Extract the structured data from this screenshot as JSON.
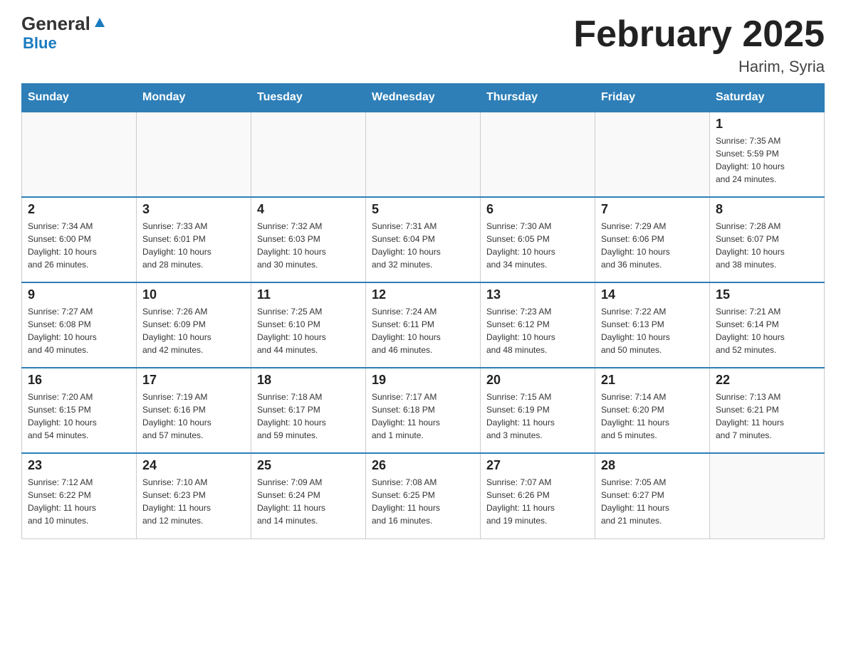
{
  "logo": {
    "general": "General",
    "blue": "Blue"
  },
  "title": "February 2025",
  "location": "Harim, Syria",
  "days_of_week": [
    "Sunday",
    "Monday",
    "Tuesday",
    "Wednesday",
    "Thursday",
    "Friday",
    "Saturday"
  ],
  "weeks": [
    [
      {
        "day": "",
        "info": ""
      },
      {
        "day": "",
        "info": ""
      },
      {
        "day": "",
        "info": ""
      },
      {
        "day": "",
        "info": ""
      },
      {
        "day": "",
        "info": ""
      },
      {
        "day": "",
        "info": ""
      },
      {
        "day": "1",
        "info": "Sunrise: 7:35 AM\nSunset: 5:59 PM\nDaylight: 10 hours\nand 24 minutes."
      }
    ],
    [
      {
        "day": "2",
        "info": "Sunrise: 7:34 AM\nSunset: 6:00 PM\nDaylight: 10 hours\nand 26 minutes."
      },
      {
        "day": "3",
        "info": "Sunrise: 7:33 AM\nSunset: 6:01 PM\nDaylight: 10 hours\nand 28 minutes."
      },
      {
        "day": "4",
        "info": "Sunrise: 7:32 AM\nSunset: 6:03 PM\nDaylight: 10 hours\nand 30 minutes."
      },
      {
        "day": "5",
        "info": "Sunrise: 7:31 AM\nSunset: 6:04 PM\nDaylight: 10 hours\nand 32 minutes."
      },
      {
        "day": "6",
        "info": "Sunrise: 7:30 AM\nSunset: 6:05 PM\nDaylight: 10 hours\nand 34 minutes."
      },
      {
        "day": "7",
        "info": "Sunrise: 7:29 AM\nSunset: 6:06 PM\nDaylight: 10 hours\nand 36 minutes."
      },
      {
        "day": "8",
        "info": "Sunrise: 7:28 AM\nSunset: 6:07 PM\nDaylight: 10 hours\nand 38 minutes."
      }
    ],
    [
      {
        "day": "9",
        "info": "Sunrise: 7:27 AM\nSunset: 6:08 PM\nDaylight: 10 hours\nand 40 minutes."
      },
      {
        "day": "10",
        "info": "Sunrise: 7:26 AM\nSunset: 6:09 PM\nDaylight: 10 hours\nand 42 minutes."
      },
      {
        "day": "11",
        "info": "Sunrise: 7:25 AM\nSunset: 6:10 PM\nDaylight: 10 hours\nand 44 minutes."
      },
      {
        "day": "12",
        "info": "Sunrise: 7:24 AM\nSunset: 6:11 PM\nDaylight: 10 hours\nand 46 minutes."
      },
      {
        "day": "13",
        "info": "Sunrise: 7:23 AM\nSunset: 6:12 PM\nDaylight: 10 hours\nand 48 minutes."
      },
      {
        "day": "14",
        "info": "Sunrise: 7:22 AM\nSunset: 6:13 PM\nDaylight: 10 hours\nand 50 minutes."
      },
      {
        "day": "15",
        "info": "Sunrise: 7:21 AM\nSunset: 6:14 PM\nDaylight: 10 hours\nand 52 minutes."
      }
    ],
    [
      {
        "day": "16",
        "info": "Sunrise: 7:20 AM\nSunset: 6:15 PM\nDaylight: 10 hours\nand 54 minutes."
      },
      {
        "day": "17",
        "info": "Sunrise: 7:19 AM\nSunset: 6:16 PM\nDaylight: 10 hours\nand 57 minutes."
      },
      {
        "day": "18",
        "info": "Sunrise: 7:18 AM\nSunset: 6:17 PM\nDaylight: 10 hours\nand 59 minutes."
      },
      {
        "day": "19",
        "info": "Sunrise: 7:17 AM\nSunset: 6:18 PM\nDaylight: 11 hours\nand 1 minute."
      },
      {
        "day": "20",
        "info": "Sunrise: 7:15 AM\nSunset: 6:19 PM\nDaylight: 11 hours\nand 3 minutes."
      },
      {
        "day": "21",
        "info": "Sunrise: 7:14 AM\nSunset: 6:20 PM\nDaylight: 11 hours\nand 5 minutes."
      },
      {
        "day": "22",
        "info": "Sunrise: 7:13 AM\nSunset: 6:21 PM\nDaylight: 11 hours\nand 7 minutes."
      }
    ],
    [
      {
        "day": "23",
        "info": "Sunrise: 7:12 AM\nSunset: 6:22 PM\nDaylight: 11 hours\nand 10 minutes."
      },
      {
        "day": "24",
        "info": "Sunrise: 7:10 AM\nSunset: 6:23 PM\nDaylight: 11 hours\nand 12 minutes."
      },
      {
        "day": "25",
        "info": "Sunrise: 7:09 AM\nSunset: 6:24 PM\nDaylight: 11 hours\nand 14 minutes."
      },
      {
        "day": "26",
        "info": "Sunrise: 7:08 AM\nSunset: 6:25 PM\nDaylight: 11 hours\nand 16 minutes."
      },
      {
        "day": "27",
        "info": "Sunrise: 7:07 AM\nSunset: 6:26 PM\nDaylight: 11 hours\nand 19 minutes."
      },
      {
        "day": "28",
        "info": "Sunrise: 7:05 AM\nSunset: 6:27 PM\nDaylight: 11 hours\nand 21 minutes."
      },
      {
        "day": "",
        "info": ""
      }
    ]
  ]
}
